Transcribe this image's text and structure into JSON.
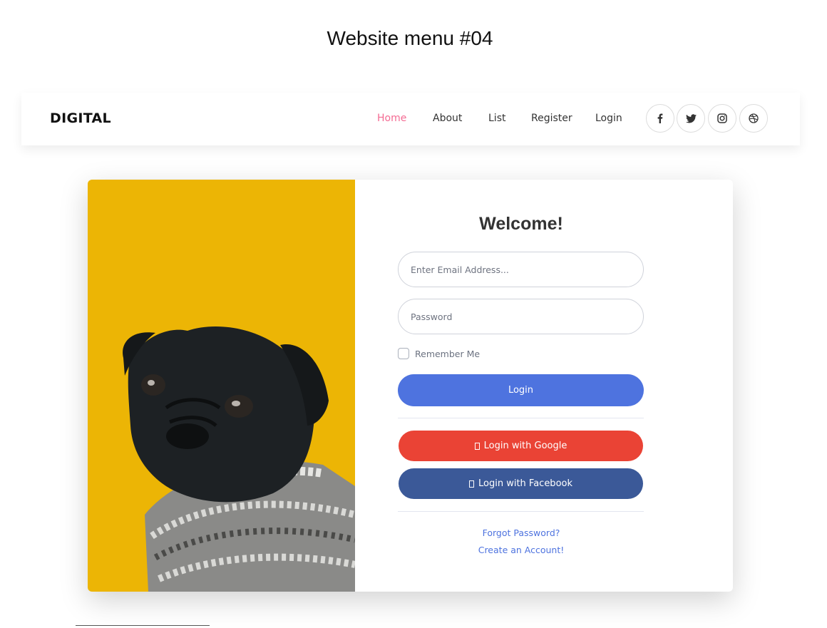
{
  "page": {
    "title": "Website menu #04"
  },
  "navbar": {
    "brand": "DIGITAL",
    "links": [
      {
        "label": "Home",
        "active": true
      },
      {
        "label": "About",
        "active": false
      },
      {
        "label": "List",
        "active": false
      },
      {
        "label": "Register",
        "active": false
      },
      {
        "label": "Login",
        "active": false
      }
    ],
    "social": [
      "facebook-icon",
      "twitter-icon",
      "instagram-icon",
      "dribbble-icon"
    ],
    "active_color": "#f46b93"
  },
  "card": {
    "image": "pug-in-sweater-photo",
    "image_bg_color": "#ecb505",
    "welcome": "Welcome!",
    "email_placeholder": "Enter Email Address...",
    "password_placeholder": "Password",
    "remember_label": "Remember Me",
    "login_label": "Login",
    "google_label": "Login with Google",
    "facebook_label": "Login with Facebook",
    "forgot_label": "Forgot Password?",
    "create_label": "Create an Account!",
    "colors": {
      "primary": "#4e73df",
      "google": "#ea4335",
      "facebook": "#3b5998"
    }
  }
}
